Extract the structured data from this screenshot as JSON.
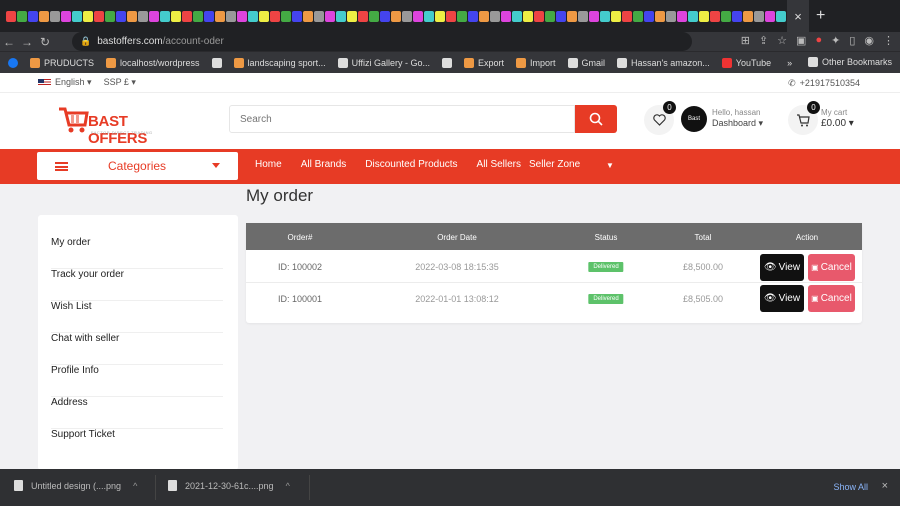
{
  "browser": {
    "url_host": "bastoffers.com",
    "url_path": "/account-oder",
    "active_tab_close": "×",
    "new_tab": "+",
    "favicon_colors": [
      "#e44",
      "#4a4",
      "#44e",
      "#e94",
      "#999",
      "#d4d",
      "#4cc",
      "#ee4",
      "#e44",
      "#4a4",
      "#44e",
      "#e94",
      "#999",
      "#d4d",
      "#4cc",
      "#ee4",
      "#e44",
      "#4a4",
      "#44e",
      "#e94",
      "#999",
      "#d4d",
      "#4cc",
      "#ee4",
      "#e44",
      "#4a4",
      "#44e",
      "#e94",
      "#999",
      "#d4d",
      "#4cc",
      "#ee4",
      "#e44",
      "#4a4",
      "#44e",
      "#e94",
      "#999",
      "#d4d",
      "#4cc",
      "#ee4",
      "#e44",
      "#4a4",
      "#44e",
      "#e94",
      "#999",
      "#d4d",
      "#4cc",
      "#ee4",
      "#e44",
      "#4a4",
      "#44e",
      "#e94",
      "#999",
      "#d4d",
      "#4cc",
      "#ee4",
      "#e44",
      "#4a4",
      "#44e",
      "#e94",
      "#999",
      "#d4d",
      "#4cc",
      "#ee4",
      "#e44",
      "#4a4",
      "#44e",
      "#e94",
      "#999",
      "#d4d",
      "#4cc"
    ],
    "bookmarks": [
      {
        "label": "PRUDUCTS",
        "color": "#e94"
      },
      {
        "label": "localhost/wordpress",
        "color": "#e94"
      },
      {
        "label": "",
        "color": "#ddd"
      },
      {
        "label": "landscaping sport...",
        "color": "#e94"
      },
      {
        "label": "Uffizi Gallery - Go...",
        "color": "#ddd"
      },
      {
        "label": "",
        "color": "#ddd"
      },
      {
        "label": "Export",
        "color": "#e94"
      },
      {
        "label": "Import",
        "color": "#e94"
      },
      {
        "label": "Gmail",
        "color": "#ddd"
      },
      {
        "label": "Hassan's amazon...",
        "color": "#ddd"
      },
      {
        "label": "YouTube",
        "color": "#e33"
      }
    ],
    "bookmarks_more": "»",
    "other_bookmarks": "Other Bookmarks"
  },
  "topbar": {
    "language": "English",
    "currency": "SSP £",
    "phone": "+21917510354"
  },
  "header": {
    "logo_name": "BAST OFFERS",
    "logo_tagline": "FACTOR DIRECT TRADING",
    "search_placeholder": "Search",
    "wishlist_count": "0",
    "avatar_text": "Bast",
    "greeting": "Hello, hassan",
    "dashboard_label": "Dashboard",
    "cart_count": "0",
    "cart_label": "My cart",
    "cart_total": "£0.00"
  },
  "nav": {
    "categories_label": "Categories",
    "links": [
      "Home",
      "All Brands",
      "Discounted Products",
      "All Sellers",
      "Seller Zone"
    ]
  },
  "page": {
    "title": "My order"
  },
  "sidebar": {
    "items": [
      "My order",
      "Track your order",
      "Wish List",
      "Chat with seller",
      "Profile Info",
      "Address",
      "Support Ticket"
    ]
  },
  "orders": {
    "headers": [
      "Order#",
      "Order Date",
      "Status",
      "Total",
      "Action"
    ],
    "rows": [
      {
        "id": "ID: 100002",
        "date": "2022-03-08 18:15:35",
        "status": "Delivered",
        "total": "£8,500.00"
      },
      {
        "id": "ID: 100001",
        "date": "2022-01-01 13:08:12",
        "status": "Delivered",
        "total": "£8,505.00"
      }
    ],
    "view_label": "View",
    "cancel_label": "Cancel"
  },
  "downloads": {
    "items": [
      "Untitled design (....png",
      "2021-12-30-61c....png"
    ],
    "show_all": "Show All",
    "close": "×"
  },
  "colors": {
    "brand": "#e73b25",
    "cancel": "#e8596c",
    "status": "#5dc26a"
  }
}
